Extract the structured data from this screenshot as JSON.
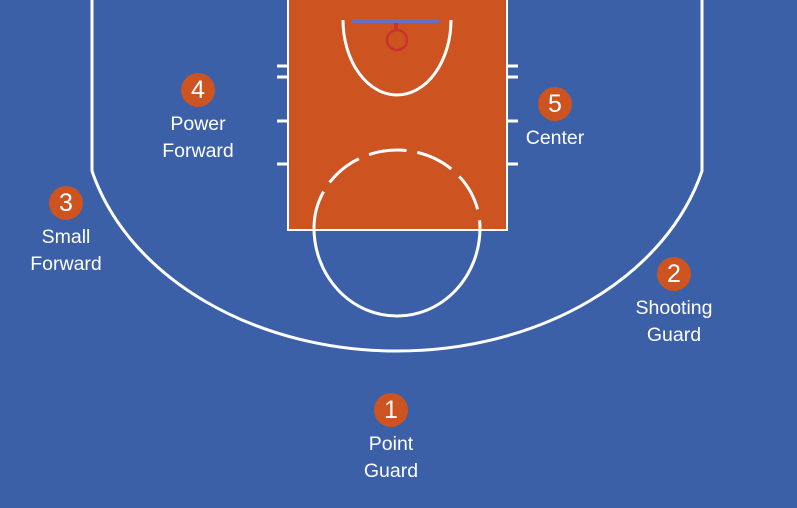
{
  "colors": {
    "court_floor": "#3b60a8",
    "key_paint": "#cd5320",
    "lines": "#ffffff",
    "badge": "#cd5320",
    "backboard": "#6272c0",
    "rim": "#c8322f"
  },
  "positions": [
    {
      "number": "1",
      "line1": "Point",
      "line2": "Guard"
    },
    {
      "number": "2",
      "line1": "Shooting",
      "line2": "Guard"
    },
    {
      "number": "3",
      "line1": "Small",
      "line2": "Forward"
    },
    {
      "number": "4",
      "line1": "Power",
      "line2": "Forward"
    },
    {
      "number": "5",
      "line1": "Center",
      "line2": ""
    }
  ]
}
